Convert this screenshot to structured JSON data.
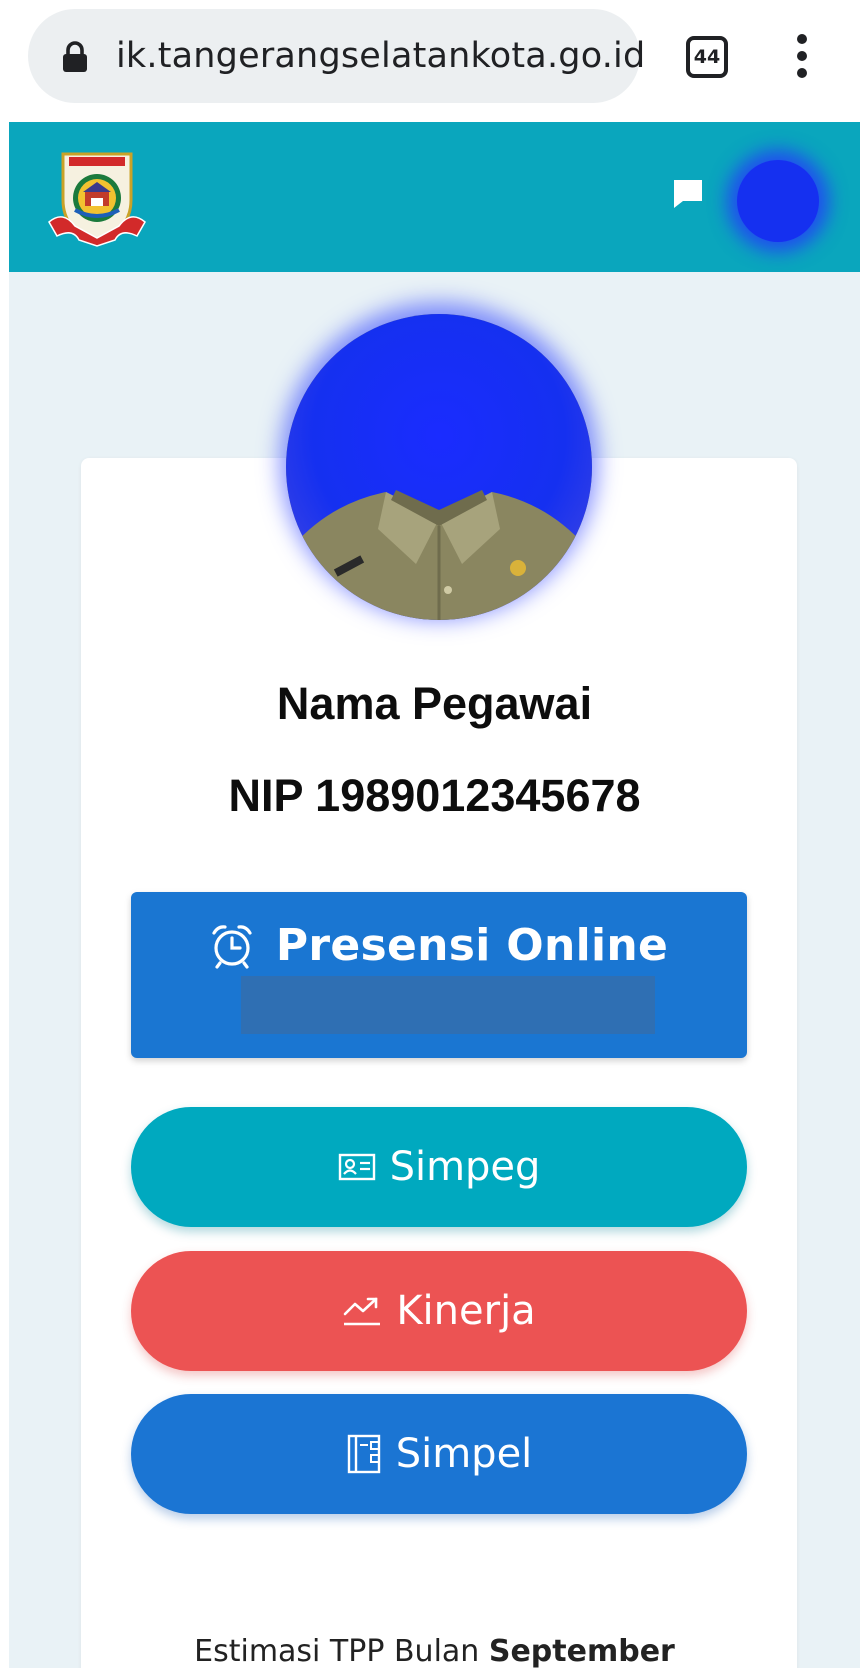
{
  "browser": {
    "url": "ik.tangerangselatankota.go.id",
    "tab_count": "44"
  },
  "header": {
    "logo": "tangerang-selatan-crest",
    "chat_icon": "chat-bubble-icon"
  },
  "profile": {
    "name": "Nama Pegawai",
    "nip": "NIP 1989012345678"
  },
  "actions": {
    "presensi_label": "Presensi Online",
    "simpeg_label": "Simpeg",
    "kinerja_label": "Kinerja",
    "simpel_label": "Simpel"
  },
  "tpp": {
    "prefix": "Estimasi TPP Bulan ",
    "month": "September"
  },
  "colors": {
    "header": "#0aa6bd",
    "presensi": "#1a76d2",
    "simpeg": "#00a9bf",
    "kinerja": "#ec5353",
    "simpel": "#1b75d3"
  }
}
